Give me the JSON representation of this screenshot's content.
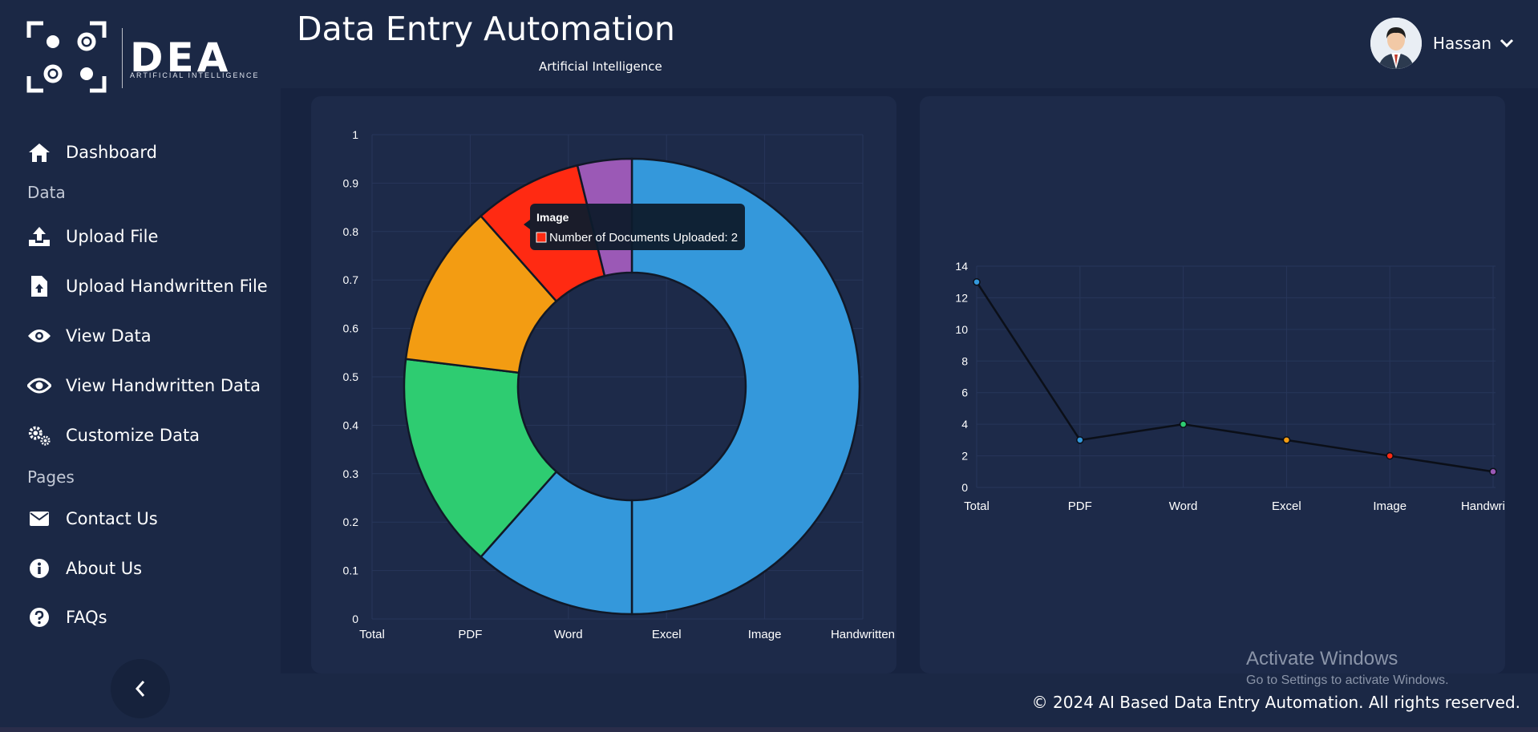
{
  "brand": {
    "logo_text": "DEA",
    "logo_sub": "ARTIFICIAL INTELLIGENCE"
  },
  "header": {
    "title": "Data Entry Automation",
    "subtitle": "Artificial Intelligence",
    "user_name": "Hassan"
  },
  "sidebar": {
    "items": [
      {
        "label": "Dashboard",
        "icon": "home-icon"
      },
      {
        "label": "Upload File",
        "icon": "upload-icon"
      },
      {
        "label": "Upload Handwritten File",
        "icon": "file-upload-icon"
      },
      {
        "label": "View Data",
        "icon": "eye-icon"
      },
      {
        "label": "View Handwritten Data",
        "icon": "eye-icon"
      },
      {
        "label": "Customize Data",
        "icon": "gears-icon"
      },
      {
        "label": "Contact Us",
        "icon": "envelope-icon"
      },
      {
        "label": "About Us",
        "icon": "info-icon"
      },
      {
        "label": "FAQs",
        "icon": "question-icon"
      }
    ],
    "sections": [
      "Data",
      "Pages"
    ]
  },
  "chart_data": [
    {
      "type": "doughnut",
      "categories": [
        "Total",
        "PDF",
        "Word",
        "Excel",
        "Image",
        "Handwritten"
      ],
      "values": [
        13,
        3,
        4,
        3,
        2,
        1
      ],
      "colors": [
        "#3498db",
        "#3498db",
        "#2ecc71",
        "#f39c12",
        "#ff2a12",
        "#9b59b6"
      ],
      "yticks": [
        "0",
        "0.1",
        "0.2",
        "0.3",
        "0.4",
        "0.5",
        "0.6",
        "0.7",
        "0.8",
        "0.9",
        "1"
      ],
      "tooltip": {
        "title": "Image",
        "label": "Number of Documents Uploaded: 2",
        "color": "#ff2a12"
      }
    },
    {
      "type": "line",
      "categories": [
        "Total",
        "PDF",
        "Word",
        "Excel",
        "Image",
        "Handwritten"
      ],
      "values": [
        13,
        3,
        4,
        3,
        2,
        1
      ],
      "point_colors": [
        "#3498db",
        "#3498db",
        "#2ecc71",
        "#f39c12",
        "#ff2a12",
        "#9b59b6"
      ],
      "ylim": [
        0,
        14
      ],
      "yticks": [
        "0",
        "2",
        "4",
        "6",
        "8",
        "10",
        "12",
        "14"
      ]
    }
  ],
  "footer": {
    "copyright": "© 2024 AI Based Data Entry Automation. All rights reserved.",
    "windows_title": "Activate Windows",
    "windows_sub": "Go to Settings to activate Windows."
  }
}
